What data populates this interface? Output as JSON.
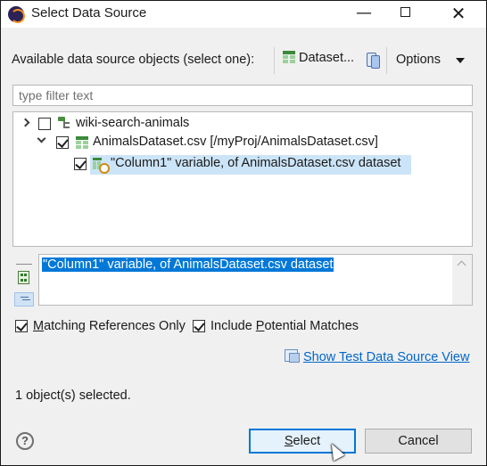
{
  "window": {
    "title": "Select Data Source",
    "minimize_glyph": "—",
    "close_glyph": "✕"
  },
  "header": {
    "label": "Available data source objects (select one):",
    "dataset_button": "Dataset...",
    "options_button": "Options"
  },
  "filter": {
    "placeholder": "type filter text",
    "value": ""
  },
  "tree": {
    "items": [
      {
        "label": "wiki-search-animals",
        "checked": false,
        "expanded": false,
        "icon": "project-icon"
      },
      {
        "label": "AnimalsDataset.csv [/myProj/AnimalsDataset.csv]",
        "checked": true,
        "expanded": true,
        "icon": "dataset-icon"
      },
      {
        "label": "\"Column1\" variable, of AnimalsDataset.csv dataset",
        "checked": true,
        "selected": true,
        "icon": "variable-icon"
      }
    ]
  },
  "detail": {
    "text": "\"Column1\" variable, of AnimalsDataset.csv dataset"
  },
  "options": {
    "matching_prefix": "",
    "matching_mnemonic": "M",
    "matching_rest": "atching References Only",
    "include_prefix": "Include ",
    "include_mnemonic": "P",
    "include_rest": "otential Matches",
    "matching_checked": true,
    "include_checked": true
  },
  "link": {
    "prefix": "",
    "mnemonic": "S",
    "rest": "how Test Data Source View"
  },
  "status": "1 object(s) selected.",
  "buttons": {
    "help": "?",
    "select_mnemonic": "S",
    "select_rest": "elect",
    "cancel": "Cancel"
  }
}
